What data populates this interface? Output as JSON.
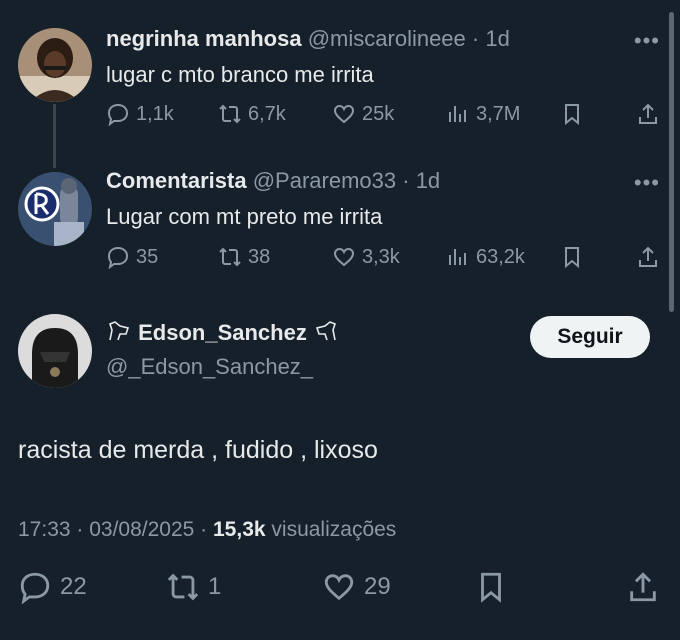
{
  "tweet1": {
    "name": "negrinha manhosa",
    "handle": "@miscarolineee",
    "time": "· 1d",
    "text": "lugar c mto branco me irrita",
    "replies": "1,1k",
    "retweets": "6,7k",
    "likes": "25k",
    "views": "3,7M"
  },
  "tweet2": {
    "name": "Comentarista",
    "handle": "@Pararemo33",
    "time": "· 1d",
    "text": "Lugar com mt preto me irrita",
    "replies": "35",
    "retweets": "38",
    "likes": "3,3k",
    "views": "63,2k"
  },
  "tweet3": {
    "name": "Edson_Sanchez",
    "handle": "@_Edson_Sanchez_",
    "follow_label": "Seguir",
    "text": "racista de merda , fudido , lixoso",
    "timestamp": "17:33 · 03/08/2025 ·",
    "views_count": "15,3k",
    "views_label": "visualizações",
    "replies": "22",
    "retweets": "1",
    "likes": "29"
  },
  "icons": {
    "reply": "reply-icon",
    "retweet": "retweet-icon",
    "like": "heart-icon",
    "views": "views-icon",
    "bookmark": "bookmark-icon",
    "share": "share-icon",
    "more": "more-icon"
  },
  "colors": {
    "background": "#16202a",
    "text": "#e7e9ea",
    "secondary": "#8b98a5",
    "button": "#eff3f4"
  }
}
